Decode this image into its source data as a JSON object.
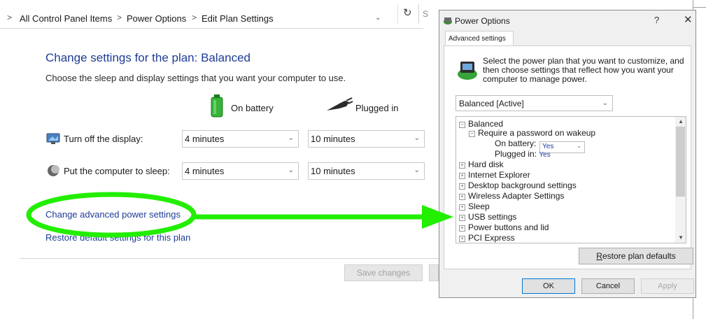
{
  "address": {
    "crumbs": [
      "All Control Panel Items",
      "Power Options",
      "Edit Plan Settings"
    ],
    "separator": ">",
    "search_stub": "S"
  },
  "main": {
    "heading": "Change settings for the plan: Balanced",
    "subtext": "Choose the sleep and display settings that you want your computer to use.",
    "columns": {
      "battery": "On battery",
      "plugged": "Plugged in"
    },
    "rows": [
      {
        "label": "Turn off the display:",
        "battery": "4 minutes",
        "plugged": "10 minutes"
      },
      {
        "label": "Put the computer to sleep:",
        "battery": "4 minutes",
        "plugged": "10 minutes"
      }
    ],
    "links": {
      "advanced": "Change advanced power settings",
      "restore": "Restore default settings for this plan"
    },
    "buttons": {
      "save": "Save changes"
    }
  },
  "dialog": {
    "title": "Power Options",
    "help": "?",
    "close": "✕",
    "tab": "Advanced settings",
    "description": "Select the power plan that you want to customize, and then choose settings that reflect how you want your computer to manage power.",
    "plan_selected": "Balanced [Active]",
    "tree": {
      "root": "Balanced",
      "password": "Require a password on wakeup",
      "on_battery_label": "On battery:",
      "on_battery_value": "Yes",
      "plugged_label": "Plugged in:",
      "plugged_value": "Yes",
      "items": [
        "Hard disk",
        "Internet Explorer",
        "Desktop background settings",
        "Wireless Adapter Settings",
        "Sleep",
        "USB settings",
        "Power buttons and lid",
        "PCI Express"
      ]
    },
    "buttons": {
      "restore": "Restore plan defaults",
      "ok": "OK",
      "cancel": "Cancel",
      "apply": "Apply"
    }
  },
  "colors": {
    "annotation": "#22ee00",
    "link": "#1e3c96"
  }
}
